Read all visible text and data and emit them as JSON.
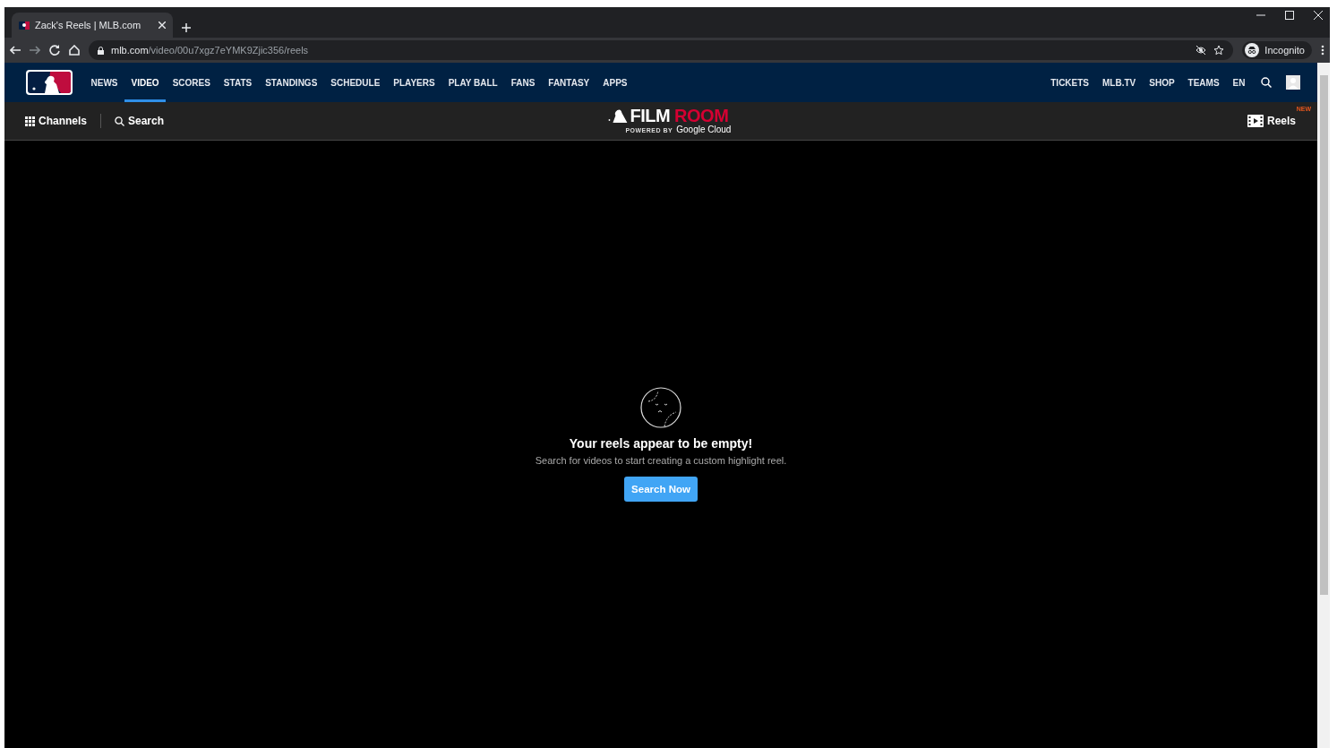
{
  "browser": {
    "tab_title": "Zack's Reels | MLB.com",
    "url_domain": "mlb.com",
    "url_path": "/video/00u7xgz7eYMK9Zjic356/reels",
    "profile_label": "Incognito"
  },
  "nav": {
    "items": [
      {
        "label": "NEWS",
        "selected": false
      },
      {
        "label": "VIDEO",
        "selected": true
      },
      {
        "label": "SCORES",
        "selected": false
      },
      {
        "label": "STATS",
        "selected": false
      },
      {
        "label": "STANDINGS",
        "selected": false
      },
      {
        "label": "SCHEDULE",
        "selected": false
      },
      {
        "label": "PLAYERS",
        "selected": false
      },
      {
        "label": "PLAY BALL",
        "selected": false
      },
      {
        "label": "FANS",
        "selected": false
      },
      {
        "label": "FANTASY",
        "selected": false
      },
      {
        "label": "APPS",
        "selected": false
      }
    ],
    "right_items": [
      "TICKETS",
      "MLB.TV",
      "SHOP",
      "TEAMS",
      "EN"
    ]
  },
  "subnav": {
    "channels": "Channels",
    "search": "Search",
    "logo_left": "FILM",
    "logo_right": "ROOM",
    "powered_by": "POWERED BY",
    "cloud": "Google Cloud",
    "reels": "Reels",
    "reels_badge": "NEW"
  },
  "empty_state": {
    "title": "Your reels appear to be empty!",
    "message": "Search for videos to start creating a custom highlight reel.",
    "button": "Search Now"
  }
}
